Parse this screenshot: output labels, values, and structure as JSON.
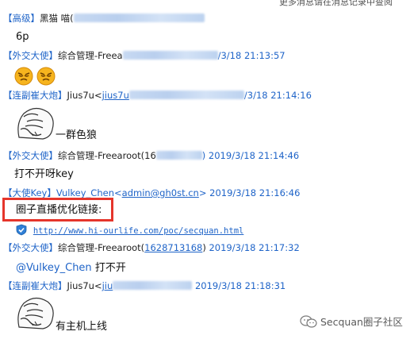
{
  "top_note": "更多消息请在消息记录中查阅",
  "messages": [
    {
      "role": "【高级】",
      "name": "黑猫 喵(",
      "name_tail": "",
      "time": "",
      "text": "6p"
    },
    {
      "role": "【外交大使】",
      "name": "综合管理-Freea",
      "name_tail": "",
      "time": "/3/18 21:13:57",
      "text": ""
    },
    {
      "role": "【连副崔大炮】",
      "name": "Jius7u<",
      "link": "jius7u",
      "name_tail": "",
      "time": "/3/18 21:14:16",
      "text": "一群色狼"
    },
    {
      "role": "【外交大使】",
      "name": "综合管理-Freearoot(16",
      "name_tail": "",
      "time": ") 2019/3/18 21:14:46",
      "text": "打不开呀key"
    },
    {
      "role": "【大使Key】",
      "name": "Vulkey_Chen<",
      "link": "admin@gh0st.cn",
      "name_tail": ">",
      "time": "2019/3/18 21:16:46",
      "text": "圈子直播优化链接:",
      "url": "http://www.hi-ourlife.com/poc/secquan.html"
    },
    {
      "role": "【外交大使】",
      "name": "综合管理-Freearoot(",
      "link": "1628713168",
      "name_tail": ")",
      "time": "2019/3/18 21:17:32",
      "mention": "@Vulkey_Chen",
      "text": "打不开"
    },
    {
      "role": "【连副崔大炮】",
      "name": "Jius7u<",
      "link": "jiu",
      "name_tail": "",
      "time": "2019/3/18 21:18:31",
      "text": "有主机上线"
    }
  ],
  "watermark": {
    "text": "Secquan圈子社区",
    "icon": "wechat-icon"
  },
  "colors": {
    "link": "#1f64c8",
    "highlight": "#e5352b"
  }
}
